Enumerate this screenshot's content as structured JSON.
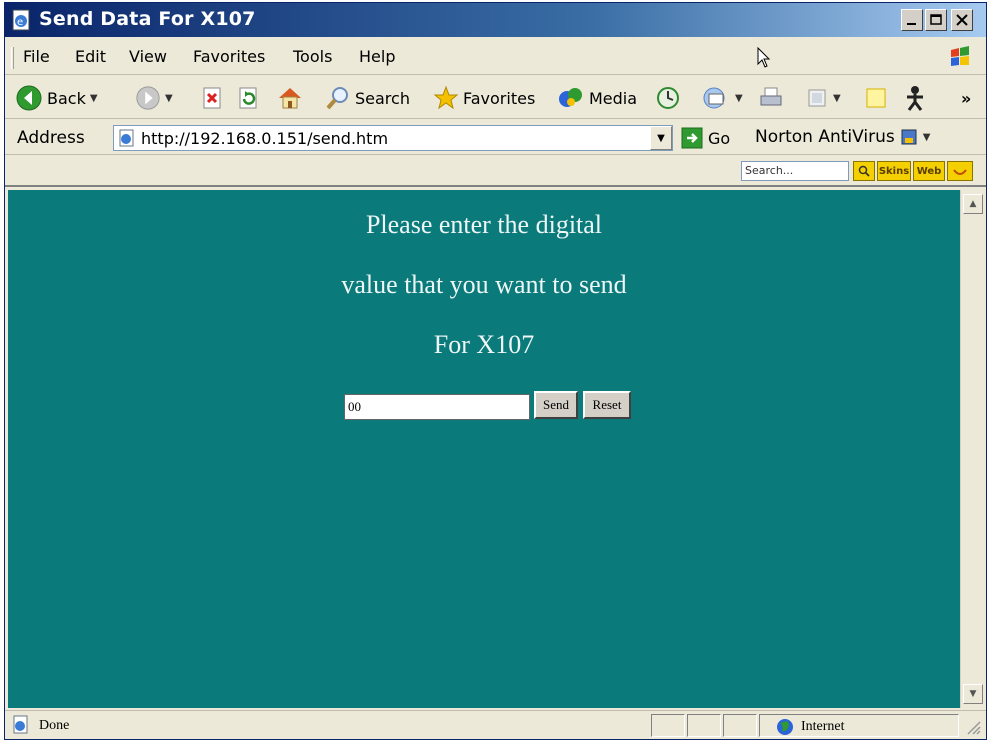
{
  "window": {
    "title": "Send Data For X107"
  },
  "menu": {
    "items": [
      "File",
      "Edit",
      "View",
      "Favorites",
      "Tools",
      "Help"
    ],
    "first_letters": [
      "F",
      "E",
      "V",
      "a",
      "T",
      "H"
    ]
  },
  "toolbar": {
    "back_label": "Back",
    "search_label": "Search",
    "favorites_label": "Favorites",
    "media_label": "Media",
    "overflow_label": "»"
  },
  "address": {
    "label": "Address",
    "url": "http://192.168.0.151/send.htm",
    "go_label": "Go",
    "norton_label": "Norton AntiVirus"
  },
  "search_toolbar": {
    "placeholder": "Search...",
    "skins_label": "Skins",
    "web_label": "Web"
  },
  "page": {
    "line1": "Please enter the digital",
    "line2": "value that you want to send",
    "line3": "For X107",
    "input_value": "00",
    "send_label": "Send",
    "reset_label": "Reset"
  },
  "status": {
    "text": "Done",
    "zone": "Internet"
  },
  "colors": {
    "content_bg": "#0b7a7b",
    "chrome_bg": "#ece9d8",
    "title_gradient_start": "#0a246a"
  }
}
